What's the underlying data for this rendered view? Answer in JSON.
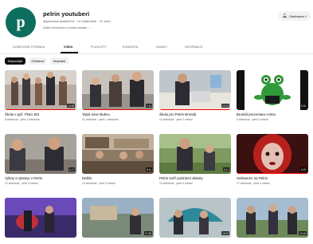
{
  "channel": {
    "avatar_letter": "p",
    "name": "pelrin youtuberi",
    "meta": "@pelrinmeubetal2018 · 14 odběratelů · 21 videí",
    "about": "Další informace o tomto kanálu",
    "about_chevron": "›",
    "subscribe_icon": "bell-icon",
    "subscribe_label": "Odebíráno ˅"
  },
  "tabs": [
    {
      "label": "Domovská stránka"
    },
    {
      "label": "Videa"
    },
    {
      "label": "Playlisty"
    },
    {
      "label": "Komunita"
    },
    {
      "label": "Kanály"
    },
    {
      "label": "Informace"
    }
  ],
  "active_tab": "Videa",
  "chips": [
    {
      "label": "Nejnovější"
    },
    {
      "label": "Oblíbené"
    },
    {
      "label": "Nejstarší"
    }
  ],
  "videos": [
    {
      "title": "Škola v pyž. Pluto 2k3",
      "meta": "8 zhlédnutí · před 1 měsícem",
      "duration": "10:38",
      "progress": 1.0
    },
    {
      "title": "Tajná mise Bubnu",
      "meta": "11 zhlédnutí · před 1 měsícem",
      "duration": "7:14",
      "progress": 1.0
    },
    {
      "title": "Škola pro Pelrin Bruntál",
      "meta": "10 zhlédnutí · před 2 měsíci",
      "duration": "10:14",
      "progress": 1.0
    },
    {
      "title": "Bruntál prezentace mima",
      "meta": "9 zhlédnutí · před 2 měsíci",
      "duration": "3:26",
      "progress": 0.0
    },
    {
      "title": "Výlety a výstavy v Pelrin",
      "meta": "12 zhlédnutí · před 3 měsíci",
      "duration": "4:17",
      "progress": 0.0
    },
    {
      "title": "Dalšin",
      "meta": "10 zhlédnutí · před 3 měsíci",
      "duration": "5:11",
      "progress": 0.0
    },
    {
      "title": "Pelrin tvoří podzimní aktivity",
      "meta": "13 zhlédnutí · před 4 měsíci",
      "duration": "6:21",
      "progress": 0.0
    },
    {
      "title": "Halloween na Pelrin",
      "meta": "17 zhlédnutí · před 4 měsíci",
      "duration": "3:15",
      "progress": 1.0
    },
    {
      "title": "",
      "meta": "",
      "duration": "",
      "progress": 0.0
    },
    {
      "title": "",
      "meta": "",
      "duration": "17:28",
      "progress": 0.0
    },
    {
      "title": "",
      "meta": "",
      "duration": "19:22",
      "progress": 0.0
    },
    {
      "title": "",
      "meta": "",
      "duration": "16:16",
      "progress": 0.0
    }
  ]
}
